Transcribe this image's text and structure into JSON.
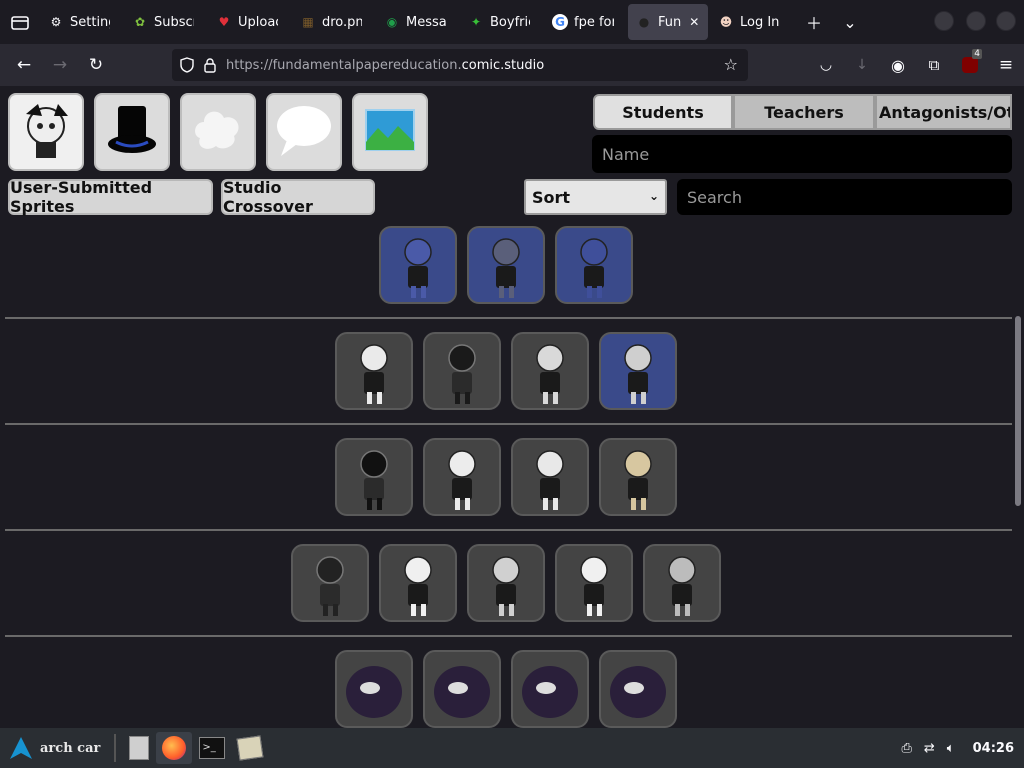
{
  "tabs": [
    {
      "title": "Setting",
      "icon": "gear-icon",
      "active": false
    },
    {
      "title": "Subscr",
      "icon": "leaf-icon",
      "active": false
    },
    {
      "title": "Uploac",
      "icon": "upload-icon",
      "active": false
    },
    {
      "title": "dro.pn",
      "icon": "image-icon",
      "active": false
    },
    {
      "title": "Messa",
      "icon": "message-icon",
      "active": false
    },
    {
      "title": "Boyfrie",
      "icon": "character-icon",
      "active": false
    },
    {
      "title": "fpe for",
      "icon": "google-icon",
      "active": false
    },
    {
      "title": "Fun",
      "icon": "app-icon",
      "active": true
    },
    {
      "title": "Log In",
      "icon": "login-icon",
      "active": false
    }
  ],
  "url": {
    "prefix": "https://fundamentalpapereducation.",
    "host": "comic.studio"
  },
  "extension_badge": "4",
  "toolbar_buttons": [
    {
      "name": "character-select-button",
      "icon": "character-icon"
    },
    {
      "name": "hat-button",
      "icon": "top-hat-icon"
    },
    {
      "name": "effect-button",
      "icon": "cloud-icon"
    },
    {
      "name": "speech-bubble-button",
      "icon": "speech-bubble-icon"
    },
    {
      "name": "background-button",
      "icon": "landscape-icon"
    }
  ],
  "secondary_buttons": {
    "user_submitted": "User-Submitted Sprites",
    "crossover": "Studio Crossover"
  },
  "category_tabs": [
    "Students",
    "Teachers",
    "Antagonists/Oth"
  ],
  "name_placeholder": "Name",
  "sort": {
    "label": "Sort"
  },
  "search_placeholder": "Search",
  "sprite_rows": [
    {
      "count": 3
    },
    {
      "count": 4
    },
    {
      "count": 4
    },
    {
      "count": 5
    },
    {
      "count": 4
    }
  ],
  "taskbar": {
    "start_label": "arch car",
    "clock": "04:26"
  }
}
